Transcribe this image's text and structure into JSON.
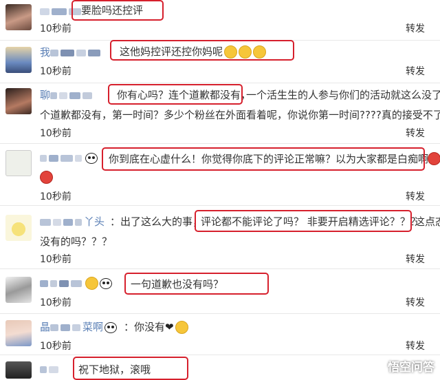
{
  "comments": [
    {
      "name": "",
      "text": "要脸吗还控评",
      "time": "10秒前",
      "forward": "转发"
    },
    {
      "name": "我",
      "text": "这他妈控评还控你妈呢",
      "time": "10秒前",
      "forward": "转发"
    },
    {
      "name": "聊",
      "text_a": "你有心吗？连个道歉都没有，",
      "text_b": "一个活生生的人参与你们的活动就这么没了。",
      "text_c": "个道歉都没有，第一时间？多少个粉丝在外面看着呢，你说你第一时间????真的接受不了。",
      "time": "10秒前",
      "forward": "转发"
    },
    {
      "name": "",
      "text": "你到底在心虚什么！你觉得你底下的评论正常嘛？以为大家都是白痴啊！",
      "time": "10秒前",
      "forward": "转发"
    },
    {
      "name": "丫头",
      "text_a": "：出了这么大的事，",
      "text_b": "评论都不能评论了吗？ 非要开启精选评论？？？",
      "text_c": "这点态",
      "text_d": "没有的吗？？？",
      "time": "10秒前",
      "forward": "转发"
    },
    {
      "name": "",
      "text": "一句道歉也没有吗？",
      "time": "10秒前",
      "forward": "转发"
    },
    {
      "name_a": "晶",
      "name_b": "菜啊",
      "text": "：你没有",
      "time": "10秒前",
      "forward": "转发"
    },
    {
      "name": "",
      "text": "祝下地狱，滚哦"
    }
  ],
  "watermark": "悟空问答",
  "colors": {
    "highlight": "#d61f2c",
    "name": "#5a7fb5"
  }
}
